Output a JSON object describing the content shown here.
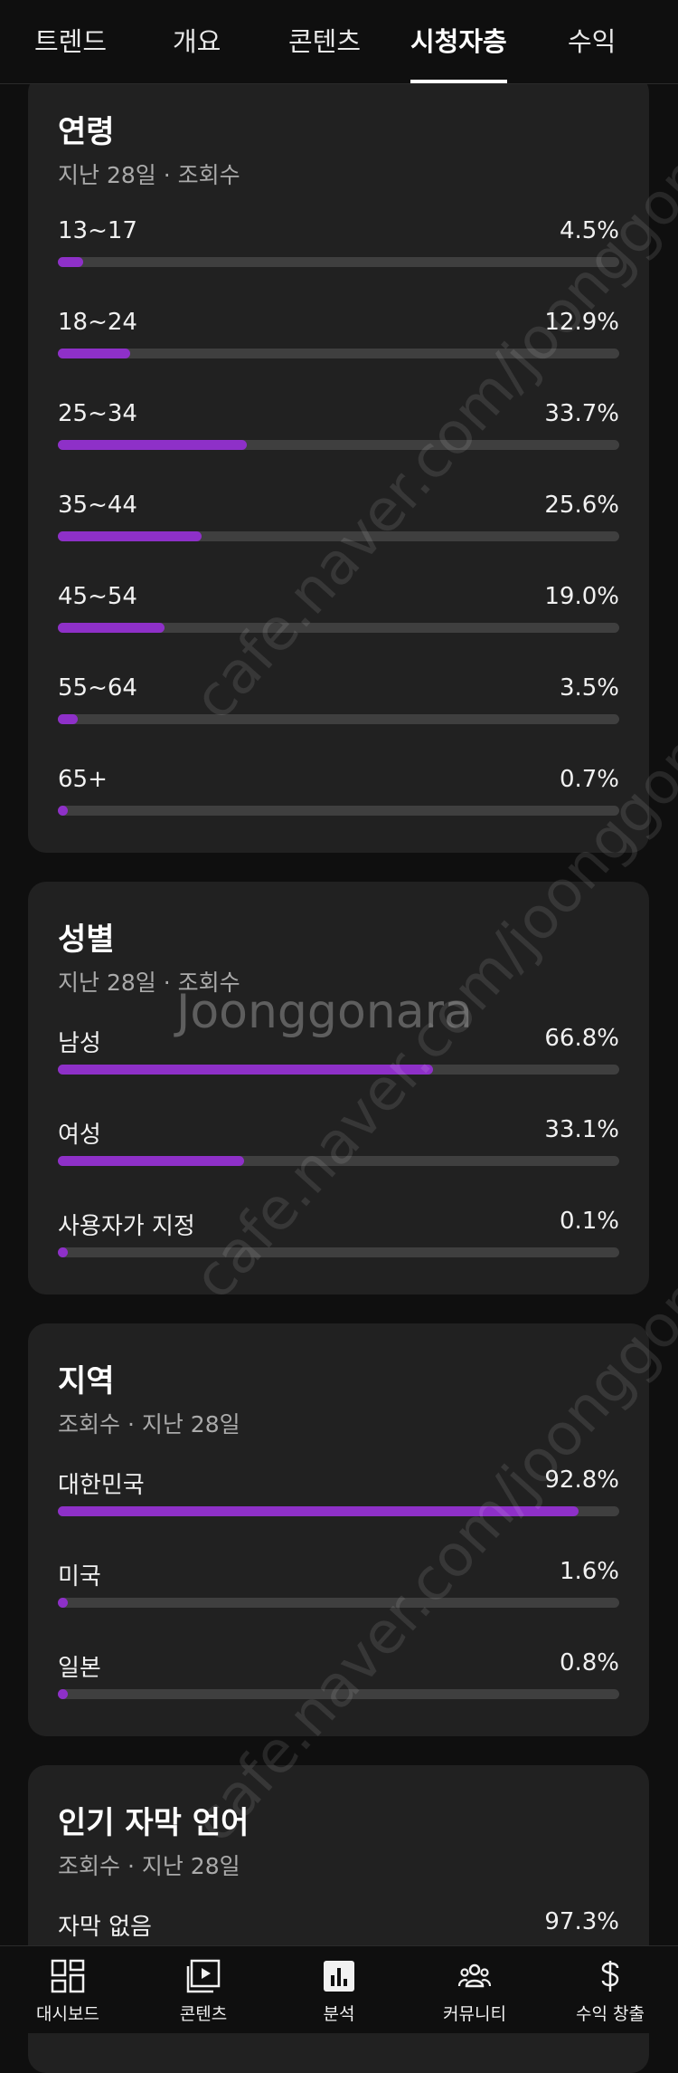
{
  "tabs": [
    {
      "label": "트렌드",
      "active": false
    },
    {
      "label": "개요",
      "active": false
    },
    {
      "label": "콘텐츠",
      "active": false
    },
    {
      "label": "시청자층",
      "active": true
    },
    {
      "label": "수익",
      "active": false
    }
  ],
  "accent_color": "#8e30c8",
  "cards": {
    "age": {
      "title": "연령",
      "subtitle": "지난 28일 · 조회수",
      "rows": [
        {
          "label": "13~17",
          "value": "4.5%",
          "percent": 4.5
        },
        {
          "label": "18~24",
          "value": "12.9%",
          "percent": 12.9
        },
        {
          "label": "25~34",
          "value": "33.7%",
          "percent": 33.7
        },
        {
          "label": "35~44",
          "value": "25.6%",
          "percent": 25.6
        },
        {
          "label": "45~54",
          "value": "19.0%",
          "percent": 19.0
        },
        {
          "label": "55~64",
          "value": "3.5%",
          "percent": 3.5
        },
        {
          "label": "65+",
          "value": "0.7%",
          "percent": 0.7
        }
      ]
    },
    "gender": {
      "title": "성별",
      "subtitle": "지난 28일 · 조회수",
      "rows": [
        {
          "label": "남성",
          "value": "66.8%",
          "percent": 66.8
        },
        {
          "label": "여성",
          "value": "33.1%",
          "percent": 33.1
        },
        {
          "label": "사용자가 지정",
          "value": "0.1%",
          "percent": 0.1
        }
      ]
    },
    "region": {
      "title": "지역",
      "subtitle": "조회수 · 지난 28일",
      "rows": [
        {
          "label": "대한민국",
          "value": "92.8%",
          "percent": 92.8
        },
        {
          "label": "미국",
          "value": "1.6%",
          "percent": 1.6
        },
        {
          "label": "일본",
          "value": "0.8%",
          "percent": 0.8
        }
      ]
    },
    "subtitles": {
      "title": "인기 자막 언어",
      "subtitle": "조회수 · 지난 28일",
      "rows": [
        {
          "label": "자막 없음",
          "value": "97.3%",
          "percent": 97.3
        }
      ]
    }
  },
  "bottom_nav": [
    {
      "label": "대시보드",
      "icon": "dashboard-icon"
    },
    {
      "label": "콘텐츠",
      "icon": "content-play-icon"
    },
    {
      "label": "분석",
      "icon": "analytics-icon"
    },
    {
      "label": "커뮤니티",
      "icon": "community-icon"
    },
    {
      "label": "수익 창출",
      "icon": "dollar-icon"
    }
  ],
  "watermark": {
    "brand": "Joonggonara",
    "url": "cafe.naver.com/joonggonara"
  }
}
